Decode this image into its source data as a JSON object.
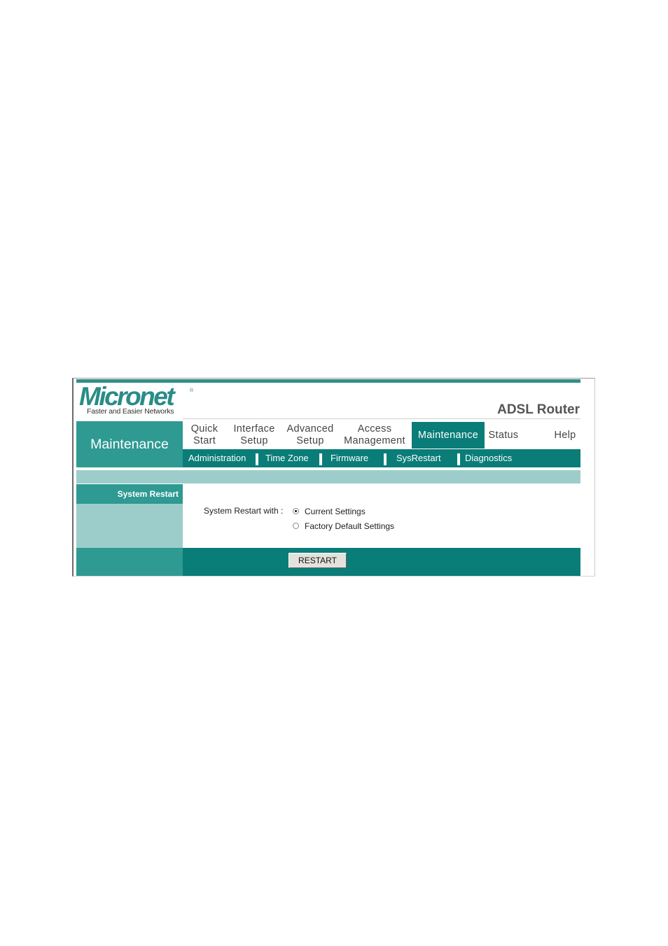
{
  "brand": {
    "logo_text": "Micronet",
    "registered_mark": "®",
    "tagline": "Faster and Easier Networks",
    "product_name": "ADSL Router"
  },
  "section_title": "Maintenance",
  "main_nav": [
    {
      "line1": "Quick",
      "line2": "Start"
    },
    {
      "line1": "Interface",
      "line2": "Setup"
    },
    {
      "line1": "Advanced",
      "line2": "Setup"
    },
    {
      "line1": "Access",
      "line2": "Management"
    },
    {
      "line1": "Maintenance",
      "line2": "",
      "active": true
    },
    {
      "line1": "Status",
      "line2": ""
    },
    {
      "line1": "Help",
      "line2": ""
    }
  ],
  "sub_nav": [
    "Administration",
    "Time Zone",
    "Firmware",
    "SysRestart",
    "Diagnostics"
  ],
  "panel": {
    "heading": "System Restart",
    "field_label": "System Restart with :",
    "options": [
      {
        "label": "Current Settings",
        "selected": true
      },
      {
        "label": "Factory Default Settings",
        "selected": false
      }
    ],
    "button_label": "RESTART"
  },
  "colors": {
    "teal_dark": "#0a7d78",
    "teal_mid": "#2e9a92",
    "teal_light": "#9dcdca",
    "logo": "#2a8c86"
  }
}
